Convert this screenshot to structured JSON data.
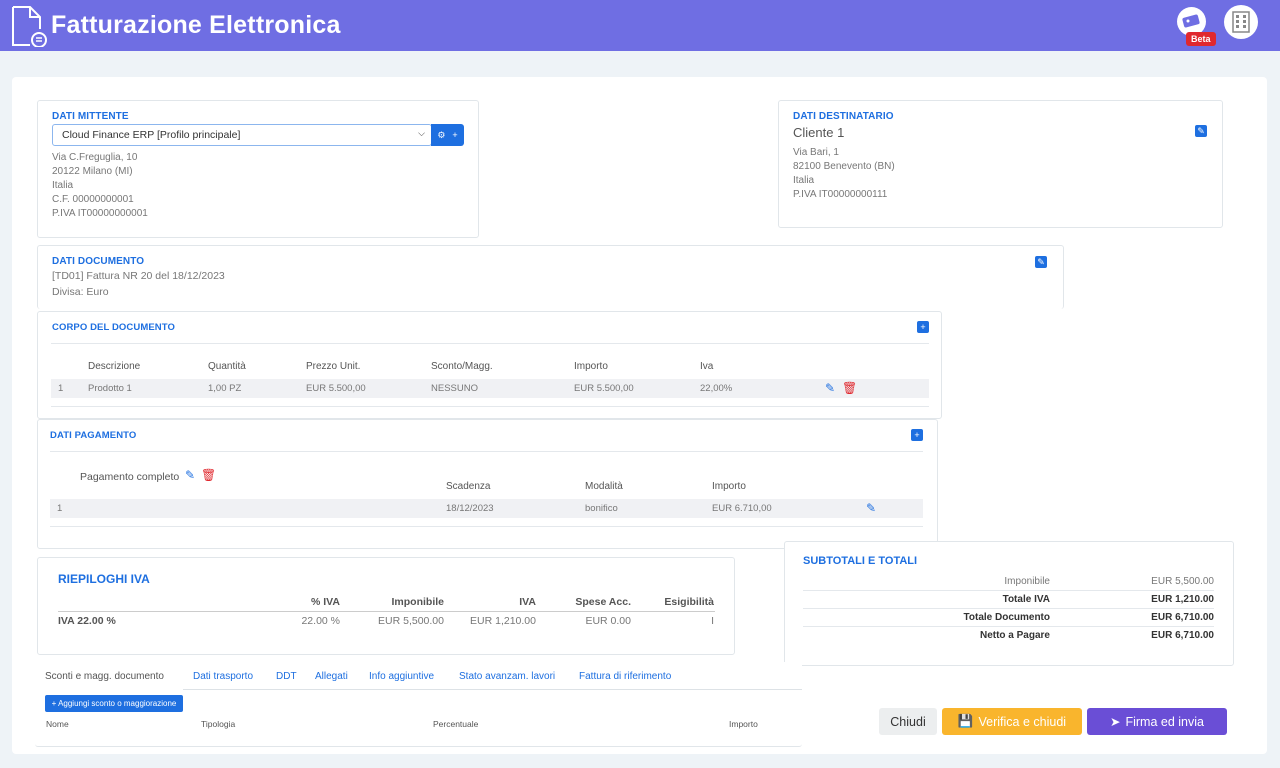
{
  "header": {
    "title": "Fatturazione Elettronica",
    "beta_badge": "Beta"
  },
  "mittente": {
    "title": "DATI MITTENTE",
    "profile_select": "Cloud Finance ERP [Profilo principale]",
    "lines": [
      "Via C.Freguglia, 10",
      "20122 Milano (MI)",
      "Italia",
      "C.F. 00000000001",
      "P.IVA IT00000000001"
    ]
  },
  "destinatario": {
    "title": "DATI DESTINATARIO",
    "name": "Cliente 1",
    "lines": [
      "Via Bari, 1",
      "82100 Benevento (BN)",
      "Italia",
      "P.IVA IT00000000111"
    ]
  },
  "documento": {
    "title": "DATI DOCUMENTO",
    "lines": [
      "[TD01] Fattura NR 20 del 18/12/2023",
      "Divisa: Euro"
    ]
  },
  "corpo": {
    "title": "CORPO DEL DOCUMENTO",
    "headers": [
      "Descrizione",
      "Quantità",
      "Prezzo Unit.",
      "Sconto/Magg.",
      "Importo",
      "Iva"
    ],
    "rows": [
      {
        "n": "1",
        "cells": [
          "Prodotto 1",
          "1,00 PZ",
          "EUR 5.500,00",
          "NESSUNO",
          "EUR 5.500,00",
          "22,00%"
        ]
      }
    ]
  },
  "pagamento": {
    "title": "DATI PAGAMENTO",
    "label": "Pagamento completo",
    "headers": [
      "Scadenza",
      "Modalità",
      "Importo"
    ],
    "rows": [
      {
        "n": "1",
        "cells": [
          "18/12/2023",
          "bonifico",
          "EUR 6.710,00"
        ]
      }
    ]
  },
  "riepiloghi": {
    "title": "RIEPILOGHI IVA",
    "headers": [
      "% IVA",
      "Imponibile",
      "IVA",
      "Spese Acc.",
      "Esigibilità"
    ],
    "rows": [
      {
        "label": "IVA 22.00 %",
        "cells": [
          "22.00 %",
          "EUR 5,500.00",
          "EUR 1,210.00",
          "EUR 0.00",
          "I"
        ]
      }
    ]
  },
  "totali": {
    "title": "SUBTOTALI E TOTALI",
    "rows": [
      {
        "label": "Imponibile",
        "value": "EUR 5,500.00"
      },
      {
        "label": "Totale IVA",
        "value": "EUR 1,210.00"
      },
      {
        "label": "Totale Documento",
        "value": "EUR 6,710.00"
      },
      {
        "label": "Netto a Pagare",
        "value": "EUR 6,710.00"
      }
    ]
  },
  "tabs": [
    "Sconti e magg. documento",
    "Dati trasporto",
    "DDT",
    "Allegati",
    "Info aggiuntive",
    "Stato avanzam. lavori",
    "Fattura di riferimento"
  ],
  "sconti": {
    "add_button": "+ Aggiungi sconto o maggiorazione",
    "headers": [
      "Nome",
      "Tipologia",
      "Percentuale",
      "Importo"
    ]
  },
  "actions": {
    "close": "Chiudi",
    "verify": "Verifica e chiudi",
    "sign": "Firma ed invia"
  },
  "colors": {
    "header_bg": "#6f6ee3",
    "accent": "#1e6fe0",
    "danger": "#e0282e",
    "verify_btn": "#f9b52d",
    "sign_btn": "#6a4ed6"
  }
}
